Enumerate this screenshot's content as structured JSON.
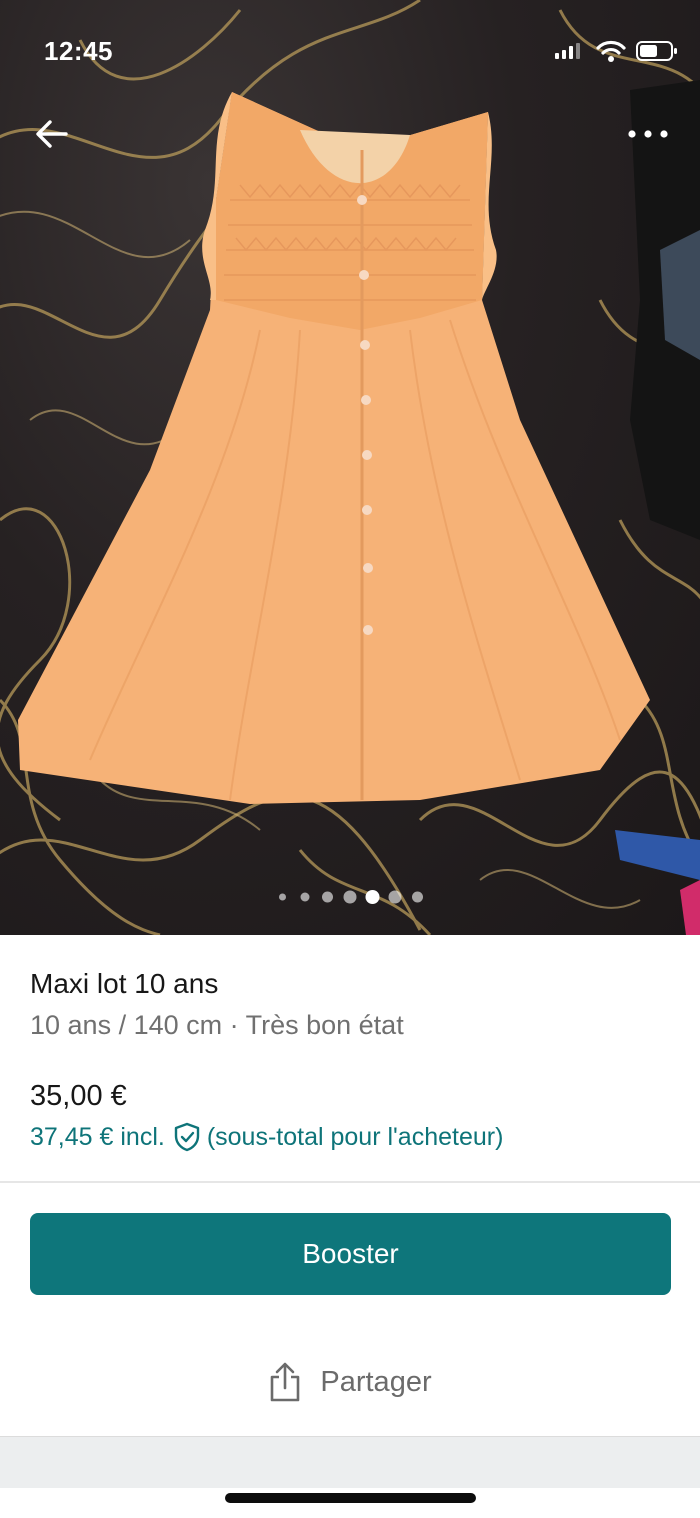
{
  "status_bar": {
    "time": "12:45"
  },
  "photo": {
    "image_count": 7,
    "current_index": 5,
    "dress_color": "#f6b277",
    "background_color": "#241f20"
  },
  "nav": {
    "back_icon": "arrow-left-icon",
    "more_icon": "ellipsis-icon"
  },
  "item": {
    "title": "Maxi lot 10 ans",
    "subtitle": "10 ans / 140 cm · Très bon état",
    "price": "35,00 €",
    "buyer_price": "37,45 € incl.",
    "buyer_note": "(sous-total pour l'acheteur)"
  },
  "actions": {
    "booster_label": "Booster",
    "share_label": "Partager"
  },
  "colors": {
    "accent": "#0e767b",
    "accent_text": "#0e7479",
    "secondary_text": "#707070"
  }
}
